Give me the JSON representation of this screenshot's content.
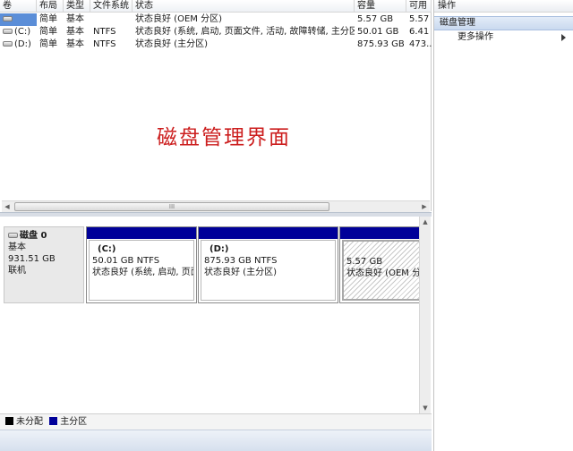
{
  "columns": [
    "卷",
    "布局",
    "类型",
    "文件系统",
    "状态",
    "容量",
    "可用"
  ],
  "volumes": [
    {
      "name": "",
      "layout": "简单",
      "type": "基本",
      "fs": "",
      "status": "状态良好 (OEM 分区)",
      "capacity": "5.57 GB",
      "free": "5.57"
    },
    {
      "name": "(C:)",
      "layout": "简单",
      "type": "基本",
      "fs": "NTFS",
      "status": "状态良好 (系统, 启动, 页面文件, 活动, 故障转储, 主分区)",
      "capacity": "50.01 GB",
      "free": "6.41"
    },
    {
      "name": "(D:)",
      "layout": "简单",
      "type": "基本",
      "fs": "NTFS",
      "status": "状态良好 (主分区)",
      "capacity": "875.93 GB",
      "free": "473.."
    }
  ],
  "caption": "磁盘管理界面",
  "hscroll_grip": "III",
  "disk": {
    "name": "磁盘 0",
    "type": "基本",
    "size": "931.51 GB",
    "state": "联机"
  },
  "partitions": [
    {
      "label": "(C:)",
      "size": "50.01 GB NTFS",
      "status": "状态良好 (系统, 启动, 页面"
    },
    {
      "label": "(D:)",
      "size": "875.93 GB NTFS",
      "status": "状态良好 (主分区)"
    },
    {
      "label": "",
      "size": "5.57 GB",
      "status": "状态良好 (OEM 分区"
    }
  ],
  "legend": {
    "unallocated": "未分配",
    "primary": "主分区",
    "unallocated_color": "#000000",
    "primary_color": "#000099"
  },
  "actions": {
    "title": "操作",
    "section": "磁盘管理",
    "more": "更多操作"
  }
}
